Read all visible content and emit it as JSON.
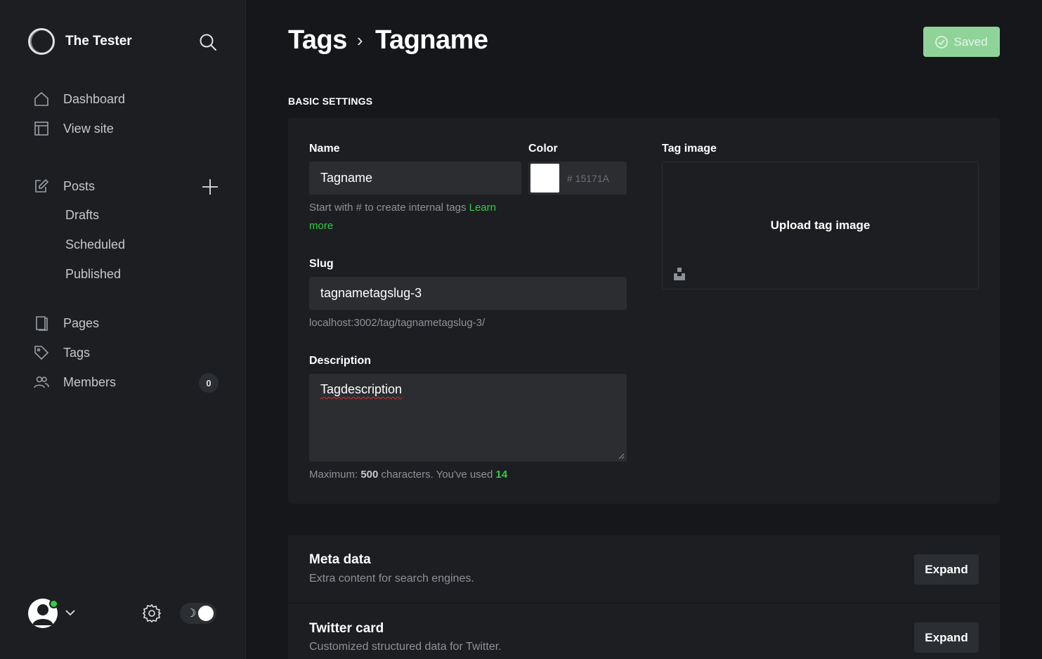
{
  "sidebar": {
    "site_name": "The Tester",
    "nav": {
      "dashboard": "Dashboard",
      "view_site": "View site",
      "posts": "Posts",
      "drafts": "Drafts",
      "scheduled": "Scheduled",
      "published": "Published",
      "pages": "Pages",
      "tags": "Tags",
      "members": "Members",
      "members_count": "0"
    },
    "theme_toggle_symbol": "☽"
  },
  "header": {
    "breadcrumb_parent": "Tags",
    "breadcrumb_sep": "›",
    "breadcrumb_current": "Tagname",
    "save_label": "Saved"
  },
  "basic": {
    "section_title": "BASIC SETTINGS",
    "name_label": "Name",
    "name_value": "Tagname",
    "name_hint": "Start with # to create internal tags",
    "name_hint_link": "Learn more",
    "color_label": "Color",
    "color_value": "# 15171A",
    "image_label": "Tag image",
    "upload_label": "Upload tag image",
    "slug_label": "Slug",
    "slug_value": "tagnametagslug-3",
    "slug_url": "localhost:3002/tag/tagnametagslug-3/",
    "description_label": "Description",
    "description_value": "Tagdescription",
    "desc_hint_prefix": "Maximum:",
    "desc_max": "500",
    "desc_hint_mid": "characters. You've used",
    "desc_used": "14"
  },
  "sections": {
    "meta_title": "Meta data",
    "meta_sub": "Extra content for search engines.",
    "twitter_title": "Twitter card",
    "twitter_sub": "Customized structured data for Twitter.",
    "expand_label": "Expand"
  },
  "colors": {
    "accent_green": "#30cf43",
    "background": "#15171a",
    "sidebar": "#1c1e21",
    "saved_button": "#8fd398"
  }
}
